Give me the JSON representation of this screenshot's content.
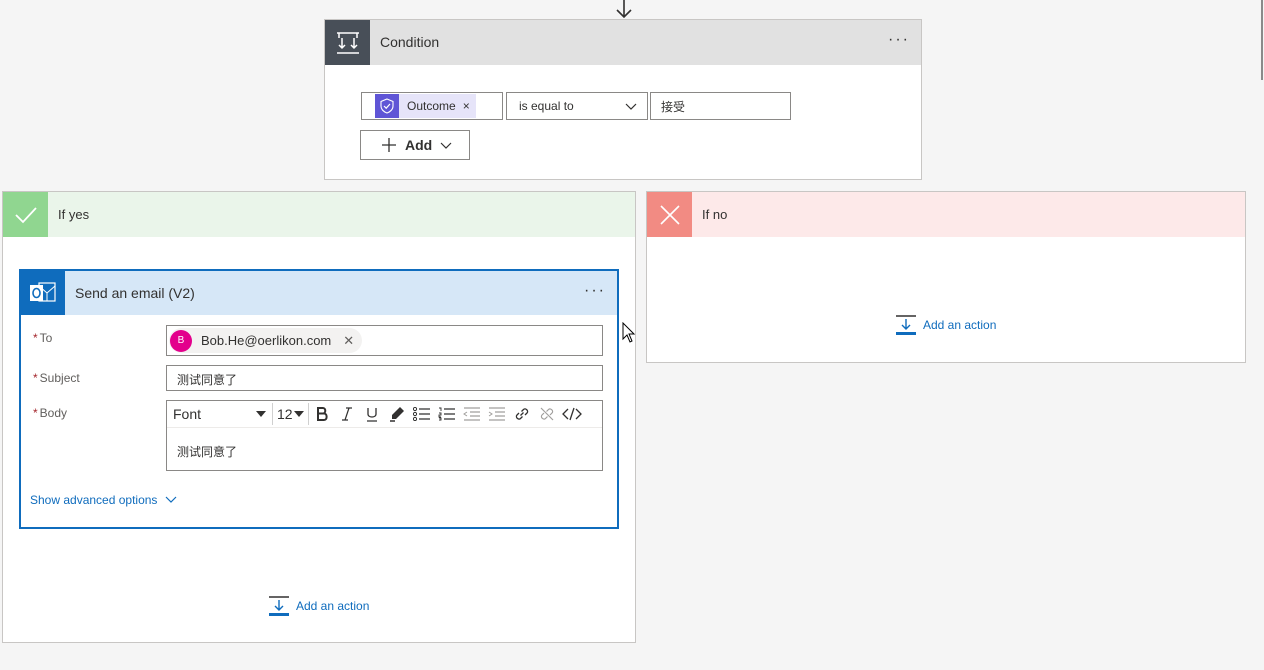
{
  "condition": {
    "title": "Condition",
    "more": "···",
    "left_token": "Outcome",
    "token_remove": "×",
    "operator": "is equal to",
    "right_value": "接受",
    "add_label": "Add"
  },
  "if_yes": {
    "title": "If yes",
    "add_action": "Add an action",
    "email": {
      "title": "Send an email (V2)",
      "more": "···",
      "to_label": "To",
      "to_avatar": "B",
      "to_value": "Bob.He@oerlikon.com",
      "to_remove": "✕",
      "subject_label": "Subject",
      "subject_value": "测试同意了",
      "body_label": "Body",
      "font_label": "Font",
      "font_size": "12",
      "body_value": "测试同意了",
      "advanced_label": "Show advanced options",
      "required_mark": "*"
    }
  },
  "if_no": {
    "title": "If no",
    "add_action": "Add an action"
  },
  "colors": {
    "accent": "#0f6cbd",
    "yes": "#90d690",
    "no": "#f28b83",
    "condition_icon_bg": "#484f58",
    "approval_icon": "#5f55d6",
    "avatar": "#e3008c"
  },
  "icons": [
    "arrow-down-icon",
    "condition-icon",
    "approval-icon",
    "chevron-down-icon",
    "plus-icon",
    "check-icon",
    "close-icon",
    "outlook-icon",
    "add-action-icon",
    "bold-icon",
    "italic-icon",
    "underline-icon",
    "highlight-icon",
    "bullet-list-icon",
    "numbered-list-icon",
    "outdent-icon",
    "indent-icon",
    "link-icon",
    "unlink-icon",
    "code-view-icon",
    "mouse-cursor-icon"
  ]
}
